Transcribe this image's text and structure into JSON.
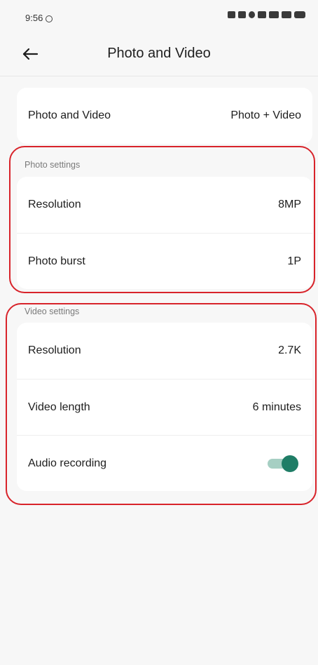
{
  "status_bar": {
    "time": "9:56"
  },
  "header": {
    "back_icon": "arrow-left-icon",
    "title": "Photo and Video"
  },
  "mode": {
    "label": "Photo and Video",
    "value": "Photo + Video"
  },
  "photo_settings": {
    "section_label": "Photo settings",
    "items": [
      {
        "label": "Resolution",
        "value": "8MP"
      },
      {
        "label": "Photo burst",
        "value": "1P"
      }
    ]
  },
  "video_settings": {
    "section_label": "Video settings",
    "items": [
      {
        "label": "Resolution",
        "value": "2.7K"
      },
      {
        "label": "Video length",
        "value": "6 minutes"
      }
    ],
    "audio": {
      "label": "Audio recording",
      "enabled": true
    }
  },
  "colors": {
    "highlight": "#d8232a",
    "toggle_on": "#1f7d66",
    "toggle_track": "#a6cfc3",
    "background": "#f7f7f7",
    "card": "#ffffff"
  }
}
